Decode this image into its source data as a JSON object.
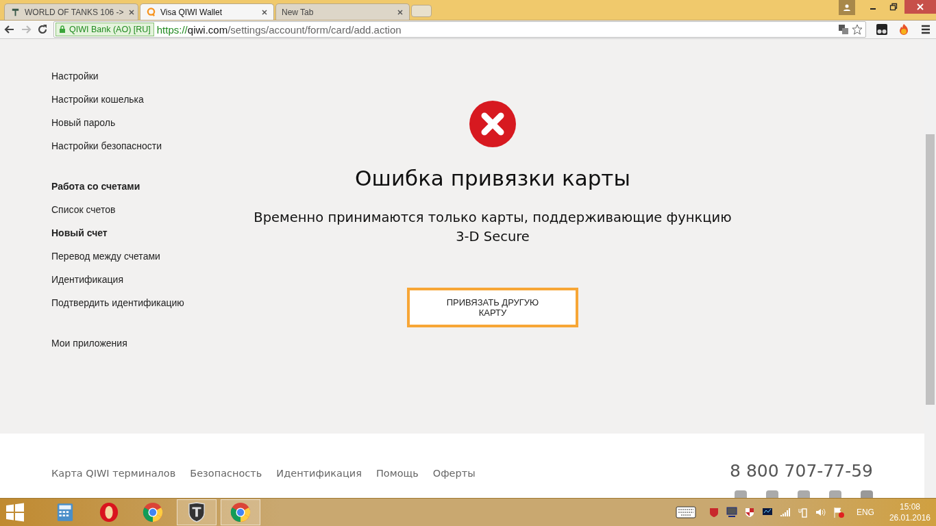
{
  "tabs": [
    {
      "title": "WORLD OF TANKS 106 ->",
      "kind": "tanks",
      "selected": false
    },
    {
      "title": "Visa QIWI Wallet",
      "kind": "qiwi",
      "selected": true
    },
    {
      "title": "New Tab",
      "kind": "blank",
      "selected": false
    }
  ],
  "address": {
    "security_label": "QIWI Bank (AO) [RU]",
    "scheme": "https://",
    "host": "qiwi.com",
    "path": "/settings/account/form/card/add.action"
  },
  "sidebar": [
    [
      {
        "label": "Настройки",
        "kind": "link",
        "selected": false
      },
      {
        "label": "Настройки кошелька",
        "kind": "link",
        "selected": false
      },
      {
        "label": "Новый пароль",
        "kind": "link",
        "selected": false
      },
      {
        "label": "Настройки безопасности",
        "kind": "link",
        "selected": false
      }
    ],
    [
      {
        "label": "Работа со счетами",
        "kind": "heading"
      },
      {
        "label": "Список счетов",
        "kind": "link",
        "selected": false
      },
      {
        "label": "Новый счет",
        "kind": "link",
        "selected": true
      },
      {
        "label": "Перевод между счетами",
        "kind": "link",
        "selected": false
      },
      {
        "label": "Идентификация",
        "kind": "link",
        "selected": false
      },
      {
        "label": "Подтвердить идентификацию",
        "kind": "link",
        "selected": false
      }
    ],
    [
      {
        "label": "Мои приложения",
        "kind": "link",
        "selected": false
      }
    ]
  ],
  "error": {
    "title": "Ошибка привязки карты",
    "message": "Временно принимаются только карты, поддерживающие функцию 3-D Secure",
    "button": "ПРИВЯЗАТЬ ДРУГУЮ КАРТУ"
  },
  "footer": {
    "links": [
      "Карта QIWI терминалов",
      "Безопасность",
      "Идентификация",
      "Помощь",
      "Оферты"
    ],
    "phone": "8 800 707-77-59"
  },
  "taskbar": {
    "apps": [
      {
        "kind": "calculator",
        "active": false
      },
      {
        "kind": "opera",
        "active": false
      },
      {
        "kind": "chrome",
        "active": false
      },
      {
        "kind": "tanks",
        "active": true
      },
      {
        "kind": "chrome",
        "active": true
      }
    ],
    "language": "ENG",
    "time": "15:08",
    "date": "26.01.2016"
  }
}
